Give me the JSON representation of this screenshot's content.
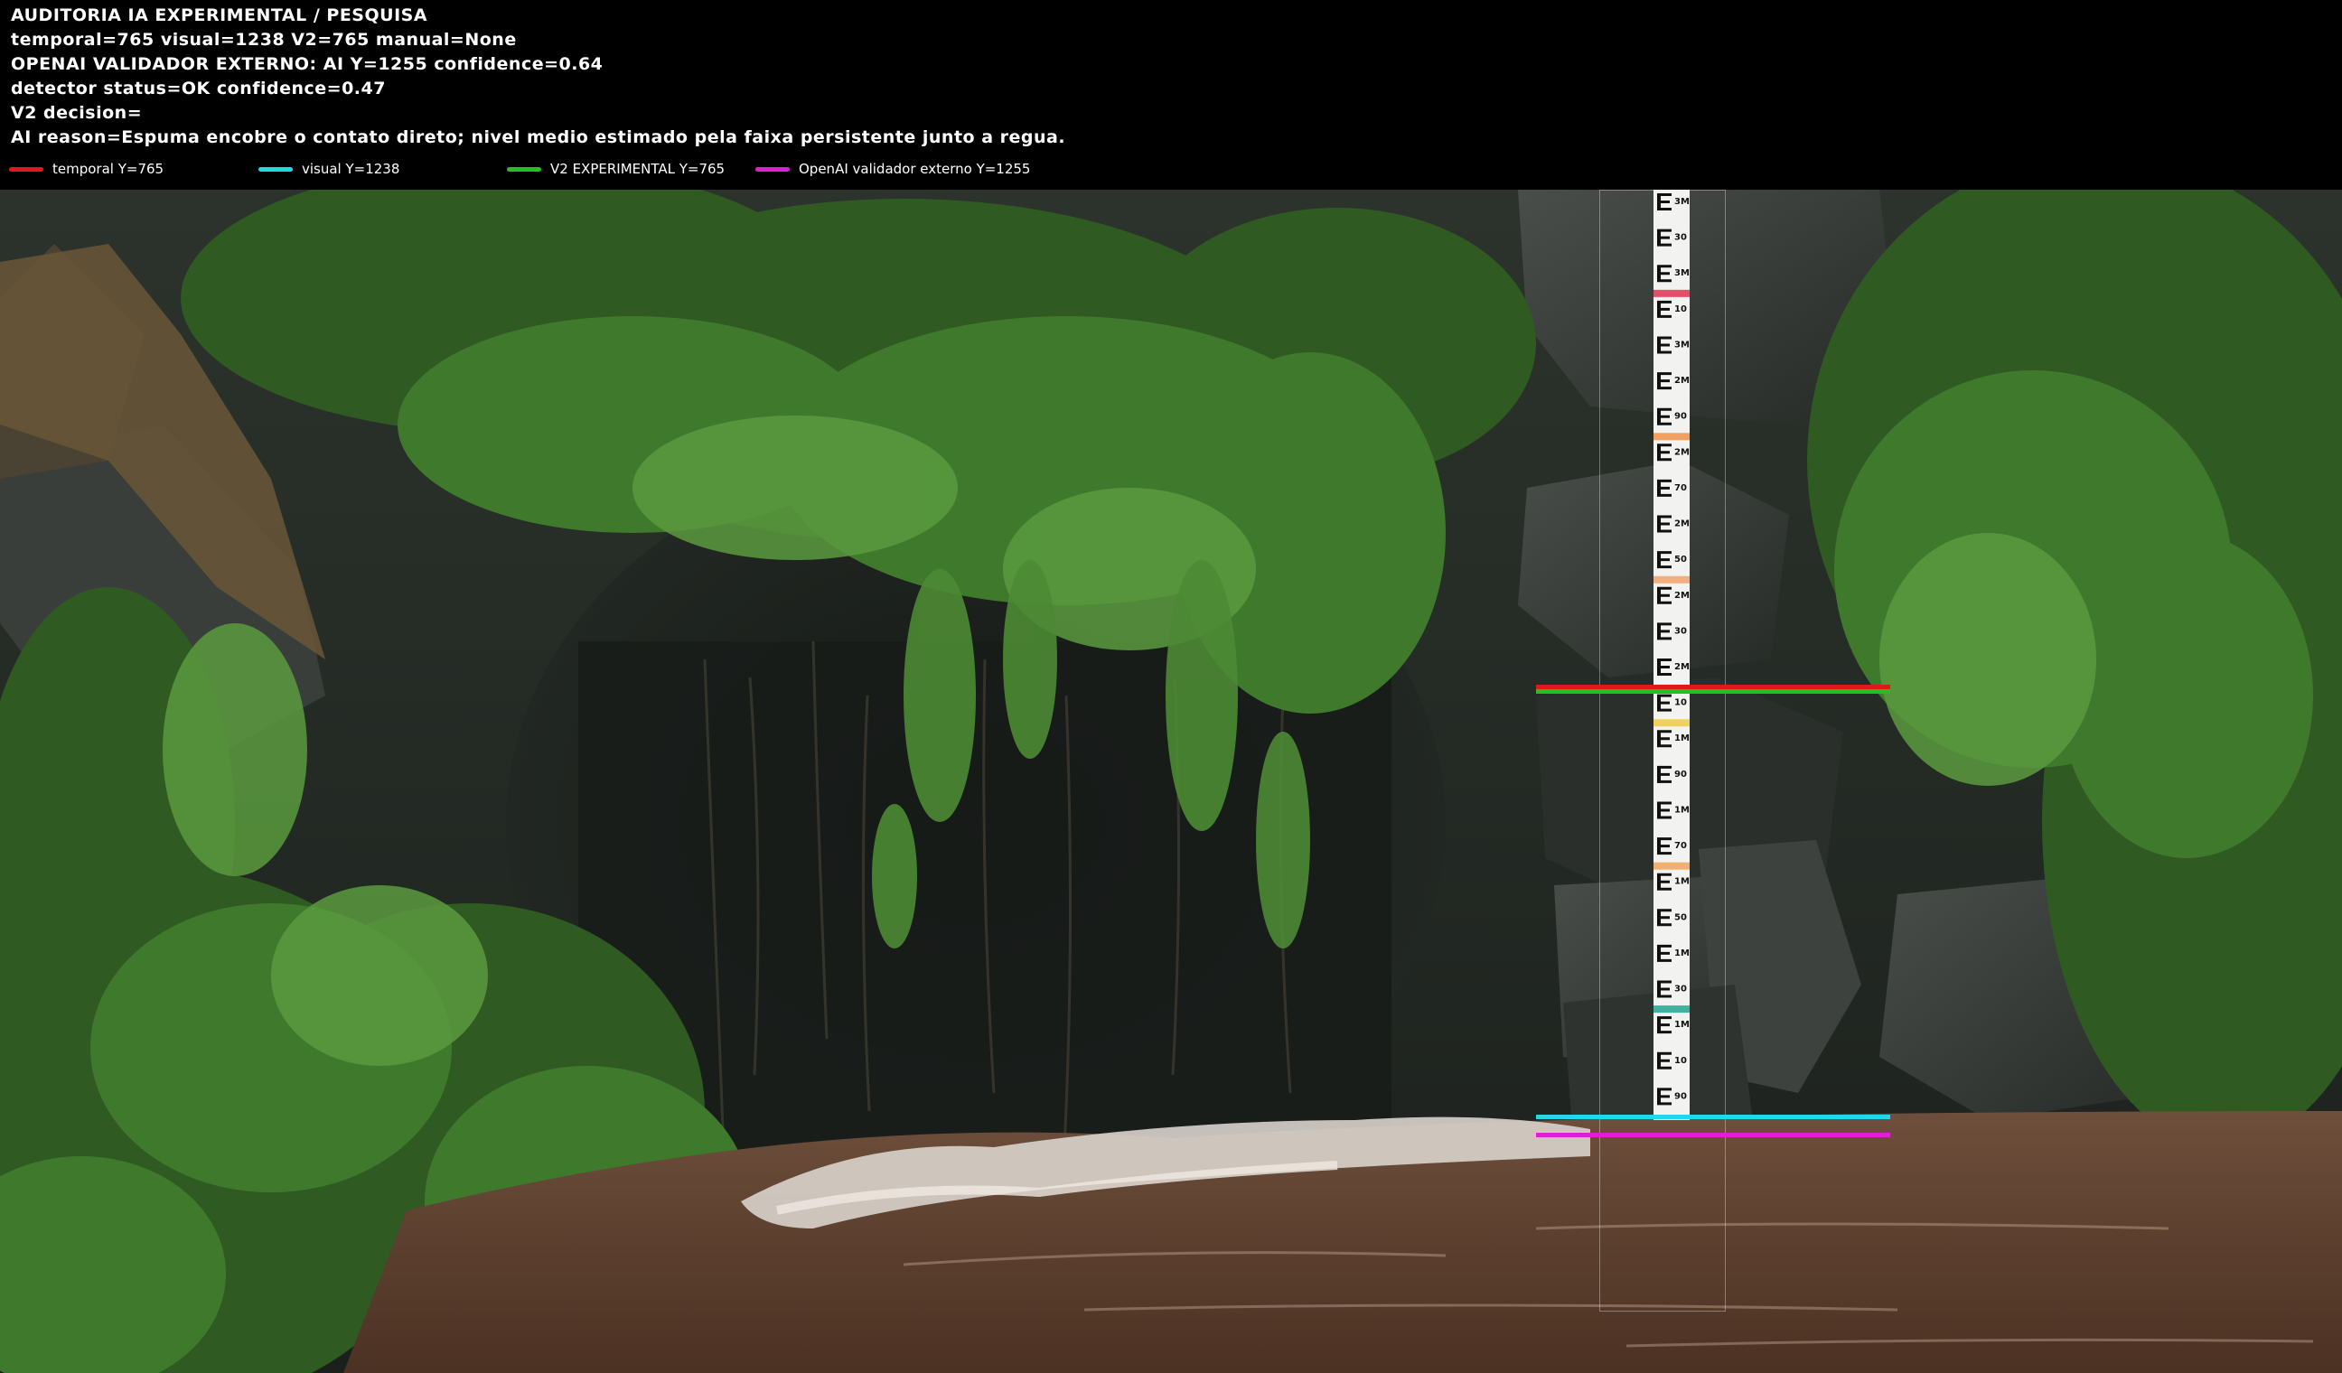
{
  "header": {
    "line1": "AUDITORIA IA  EXPERIMENTAL / PESQUISA",
    "line2": "temporal=765  visual=1238  V2=765  manual=None",
    "line3": "OPENAI  VALIDADOR EXTERNO: AI Y=1255  confidence=0.64",
    "line4": "detector status=OK confidence=0.47",
    "line5": "V2 decision=",
    "line6": "AI reason=Espuma encobre o contato direto; nivel medio estimado pela faixa persistente junto a regua."
  },
  "legend": [
    {
      "label": "temporal Y=765",
      "color": "#e01818"
    },
    {
      "label": "visual Y=1238",
      "color": "#22d8e8"
    },
    {
      "label": "V2 EXPERIMENTAL Y=765",
      "color": "#22c022"
    },
    {
      "label": "OpenAI validador externo Y=1255",
      "color": "#e020d0"
    }
  ],
  "gauge_labels": [
    "3M",
    "30",
    "3M",
    "10",
    "3M",
    "2M",
    "90",
    "2M",
    "70",
    "2M",
    "50",
    "2M",
    "30",
    "2M",
    "10",
    "1M",
    "90",
    "1M",
    "70",
    "1M",
    "50",
    "1M",
    "30",
    "1M",
    "10",
    "90"
  ],
  "colors": {
    "temporal": "#e01818",
    "visual": "#22d8e8",
    "v2": "#22c022",
    "openai": "#e020d0"
  }
}
